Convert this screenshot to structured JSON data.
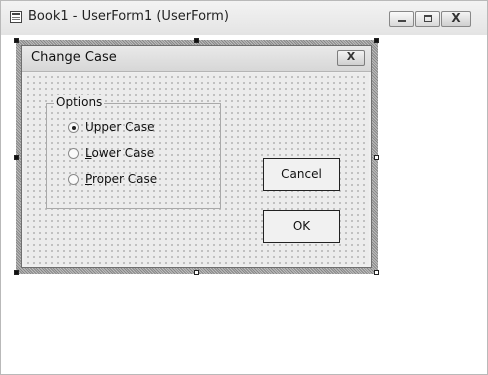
{
  "ide_window": {
    "title": "Book1 - UserForm1 (UserForm)",
    "icon": "worksheet-icon",
    "controls": {
      "minimize": "minimize-icon",
      "maximize": "maximize-icon",
      "close": "X"
    }
  },
  "userform": {
    "title": "Change Case",
    "close_glyph": "X",
    "frame": {
      "label": "Options",
      "options": [
        {
          "accel": "",
          "rest": "Upper Case",
          "checked": true
        },
        {
          "accel": "L",
          "rest": "ower Case",
          "checked": false
        },
        {
          "accel": "P",
          "rest": "roper Case",
          "checked": false
        }
      ]
    },
    "buttons": {
      "cancel": "Cancel",
      "ok": "OK"
    }
  },
  "colors": {
    "form_background": "#ececec",
    "selection_hatch": "#9a9a9a"
  }
}
